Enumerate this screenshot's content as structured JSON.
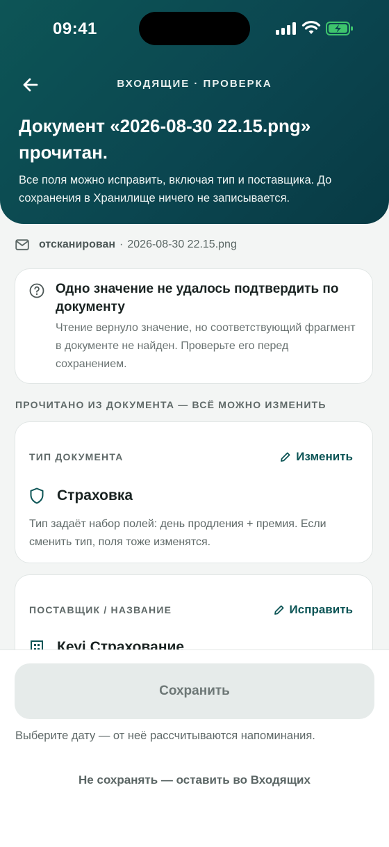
{
  "status_bar": {
    "time": "09:41"
  },
  "header": {
    "breadcrumb": "ВХОДЯЩИЕ · ПРОВЕРКА",
    "title": "Документ «2026-08-30 22.15.png» прочитан.",
    "subtitle": "Все поля можно исправить, включая тип и поставщика. До сохранения в Хранилище ничего не записывается."
  },
  "meta": {
    "status": "отсканирован",
    "separator": "·",
    "filename": "2026-08-30 22.15.png"
  },
  "warning": {
    "title": "Одно значение не удалось подтвердить по документу",
    "text": "Чтение вернуло значение, но соответствующий фрагмент в документе не найден. Проверьте его перед сохранением."
  },
  "section_label": "ПРОЧИТАНО ИЗ ДОКУМЕНТА — ВСЁ МОЖНО ИЗМЕНИТЬ",
  "type_card": {
    "label": "ТИП ДОКУМЕНТА",
    "action": "Изменить",
    "value": "Страховка",
    "hint": "Тип задаёт набор полей: день продления + премия. Если сменить тип, поля тоже изменятся."
  },
  "supplier_card": {
    "label": "ПОСТАВЩИК / НАЗВАНИЕ",
    "action": "Исправить",
    "value": "Кеуі Страхование"
  },
  "footer": {
    "save_label": "Сохранить",
    "save_hint": "Выберите дату — от неё рассчитываются напоминания.",
    "discard_label": "Не сохранять — оставить во Входящих"
  },
  "colors": {
    "header": "#0b4650",
    "accent": "#0d5556",
    "battery": "#3ec46d"
  }
}
